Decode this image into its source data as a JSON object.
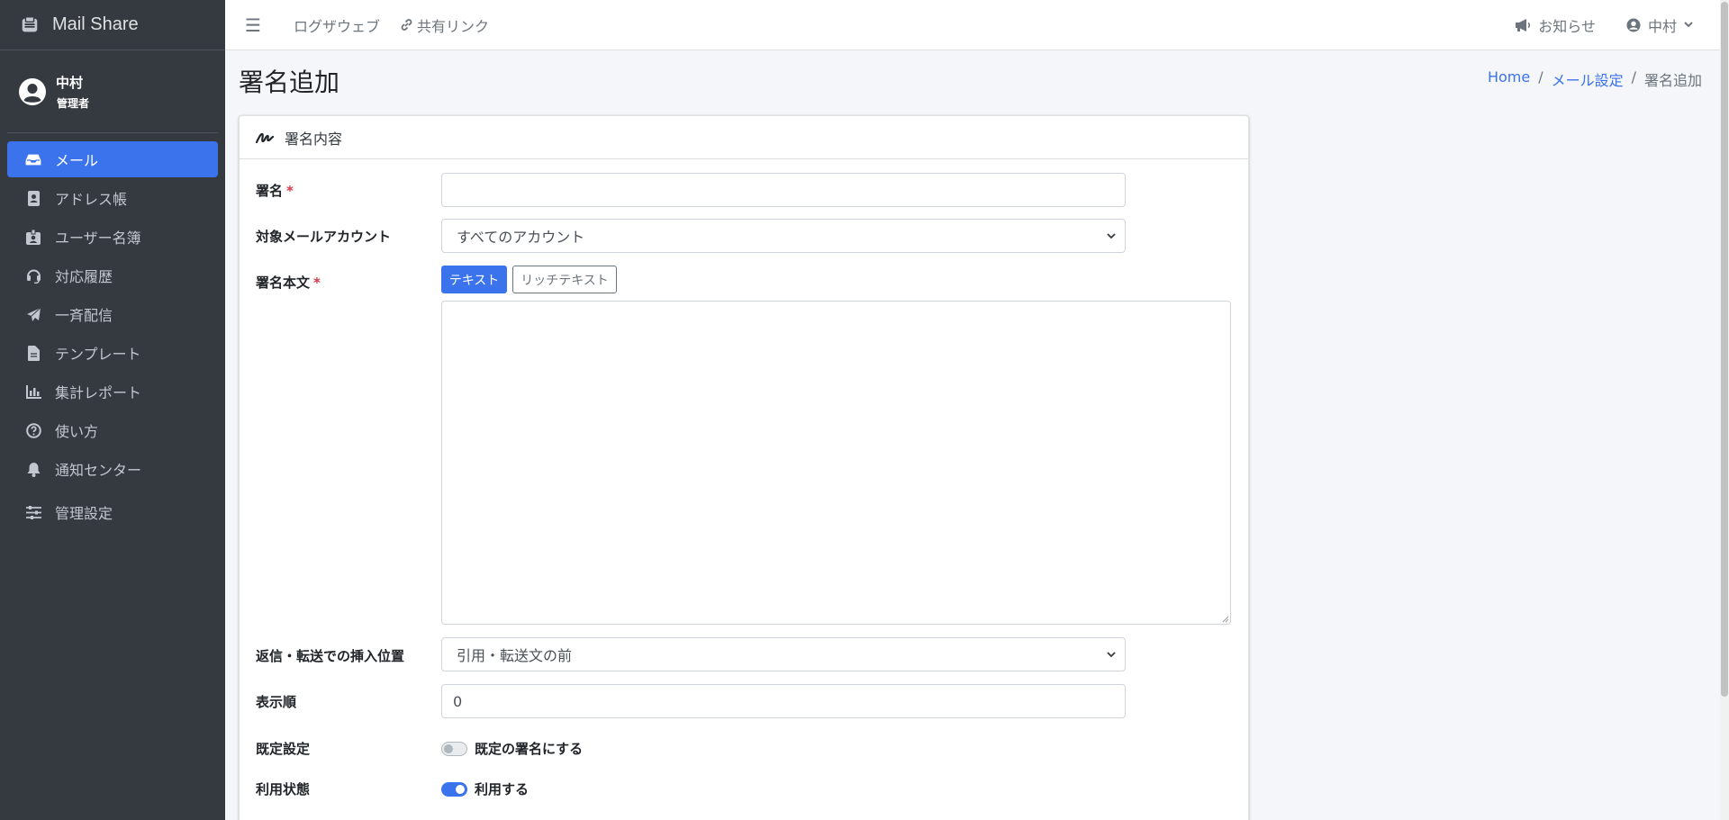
{
  "app": {
    "name": "Mail Share"
  },
  "user": {
    "name": "中村",
    "role": "管理者"
  },
  "sidebar": {
    "items": [
      {
        "label": "メール",
        "icon": "inbox-icon"
      },
      {
        "label": "アドレス帳",
        "icon": "address-book-icon"
      },
      {
        "label": "ユーザー名簿",
        "icon": "id-badge-icon"
      },
      {
        "label": "対応履歴",
        "icon": "headset-icon"
      },
      {
        "label": "一斉配信",
        "icon": "paper-plane-icon"
      },
      {
        "label": "テンプレート",
        "icon": "file-icon"
      },
      {
        "label": "集計レポート",
        "icon": "chart-bar-icon"
      },
      {
        "label": "使い方",
        "icon": "question-circle-icon"
      },
      {
        "label": "通知センター",
        "icon": "bell-icon"
      },
      {
        "label": "管理設定",
        "icon": "sliders-icon"
      }
    ],
    "active_index": 0
  },
  "topbar": {
    "links": [
      "ログザウェブ",
      "共有リンク"
    ],
    "notifications": "お知らせ",
    "user_menu": "中村"
  },
  "page": {
    "title": "署名追加",
    "breadcrumb": [
      "Home",
      "メール設定",
      "署名追加"
    ]
  },
  "card": {
    "title": "署名内容",
    "fields": {
      "signature_label": "署名",
      "signature_value": "",
      "account_label": "対象メールアカウント",
      "account_value": "すべてのアカウント",
      "body_label": "署名本文",
      "body_tab_text": "テキスト",
      "body_tab_rich": "リッチテキスト",
      "position_label": "返信・転送での挿入位置",
      "position_value": "引用・転送文の前",
      "order_label": "表示順",
      "order_value": "0",
      "default_label": "既定設定",
      "default_switch": "既定の署名にする",
      "status_label": "利用状態",
      "status_switch": "利用する"
    },
    "required_mark": "*"
  },
  "colors": {
    "primary": "#3b73ed",
    "sidebar_bg": "#343a40",
    "required": "#dc3545"
  }
}
